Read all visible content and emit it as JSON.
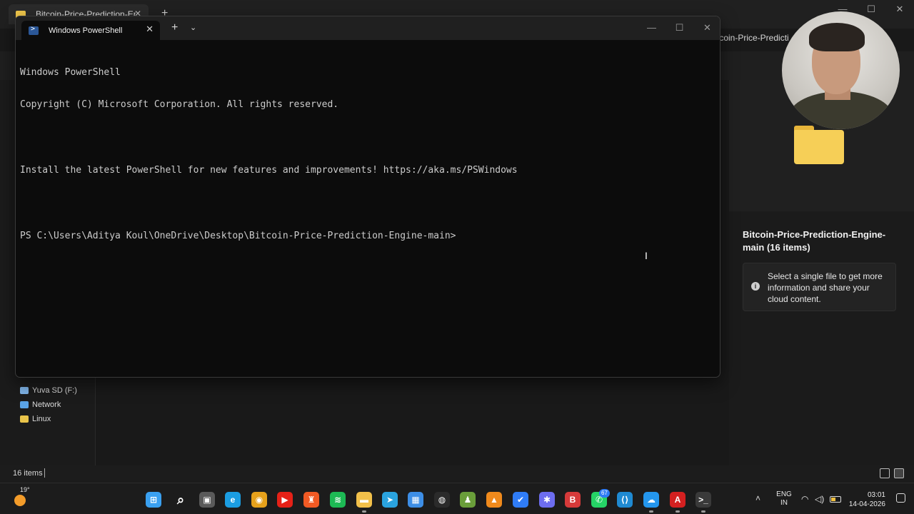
{
  "explorer": {
    "tab_title": "Bitcoin-Price-Prediction-Engine-main",
    "new_tab_label": "+",
    "address_fragment": "tcoin-Price-Predicti",
    "nav_items": [
      {
        "label": "Yuva SD (F:)",
        "icon": "sd-card-icon",
        "color": "#7fb4e8"
      },
      {
        "label": "Network",
        "icon": "network-icon",
        "color": "#5aa3e6"
      },
      {
        "label": "Linux",
        "icon": "linux-penguin-icon",
        "color": "#e9c44a"
      }
    ],
    "details": {
      "title": "Bitcoin-Price-Prediction-Engine-main (16 items)",
      "info_text": "Select a single file to get more information and share your cloud content."
    },
    "status": {
      "item_count": "16 items"
    }
  },
  "terminal": {
    "tab_title": "Windows PowerShell",
    "lines": [
      "Windows PowerShell",
      "Copyright (C) Microsoft Corporation. All rights reserved.",
      "",
      "Install the latest PowerShell for new features and improvements! https://aka.ms/PSWindows",
      "",
      "PS C:\\Users\\Aditya Koul\\OneDrive\\Desktop\\Bitcoin-Price-Prediction-Engine-main>"
    ]
  },
  "taskbar": {
    "weather_temp": "19°",
    "apps": [
      {
        "name": "start-button",
        "color": "#3aa0f0",
        "glyph": "⊞"
      },
      {
        "name": "search-icon",
        "color": "#1c1c1c",
        "glyph": "⌕"
      },
      {
        "name": "task-view-icon",
        "color": "#5a5a5a",
        "glyph": "▣"
      },
      {
        "name": "edge-icon",
        "color": "#1b9de2",
        "glyph": "e"
      },
      {
        "name": "chrome-icon",
        "color": "#e6a11b",
        "glyph": "◉"
      },
      {
        "name": "youtube-icon",
        "color": "#e62117",
        "glyph": "▶"
      },
      {
        "name": "brave-icon",
        "color": "#f15a24",
        "glyph": "♜"
      },
      {
        "name": "spotify-icon",
        "color": "#1db954",
        "glyph": "≋"
      },
      {
        "name": "file-explorer-icon",
        "color": "#f2c04a",
        "glyph": "▬"
      },
      {
        "name": "telegram-icon",
        "color": "#2aa3df",
        "glyph": "➤"
      },
      {
        "name": "store-icon",
        "color": "#3d8ee6",
        "glyph": "▦"
      },
      {
        "name": "github-icon",
        "color": "#2b2b2b",
        "glyph": "◍"
      },
      {
        "name": "chess-icon",
        "color": "#6a9e3a",
        "glyph": "♟"
      },
      {
        "name": "vlc-icon",
        "color": "#f08a1c",
        "glyph": "▲"
      },
      {
        "name": "todo-icon",
        "color": "#2f7cf6",
        "glyph": "✔"
      },
      {
        "name": "settings-app-icon",
        "color": "#6d6df0",
        "glyph": "✱"
      },
      {
        "name": "bitwarden-icon",
        "color": "#d63a3a",
        "glyph": "B"
      },
      {
        "name": "whatsapp-icon",
        "color": "#25d366",
        "glyph": "✆"
      },
      {
        "name": "vscode-icon",
        "color": "#1f8ad2",
        "glyph": "⟨⟩"
      },
      {
        "name": "docker-icon",
        "color": "#2496ed",
        "glyph": "☁"
      },
      {
        "name": "acrobat-icon",
        "color": "#d42020",
        "glyph": "A"
      },
      {
        "name": "terminal-icon",
        "color": "#3a3a3a",
        "glyph": ">_"
      }
    ],
    "whatsapp_badge": "67",
    "language": [
      "ENG",
      "IN"
    ],
    "time": "03:01",
    "date": "14-04-2026"
  }
}
